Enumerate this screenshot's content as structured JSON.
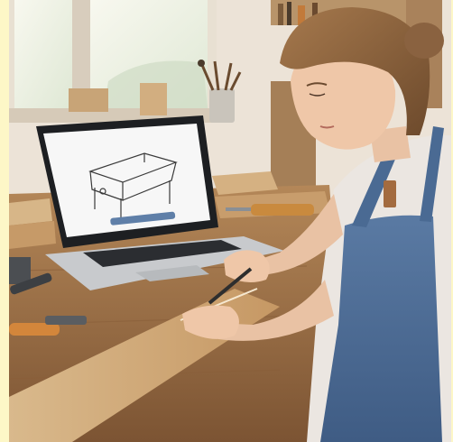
{
  "image": {
    "alt": "",
    "border_color": "#fdf7c7",
    "laptop_screen_color": "#f7f7f7",
    "apron_color": "#4d6c94",
    "shirt_color": "#ece7e2",
    "wood_color": "#c79b66",
    "bench_color": "#9b7047",
    "wall_color": "#efe7dc"
  }
}
